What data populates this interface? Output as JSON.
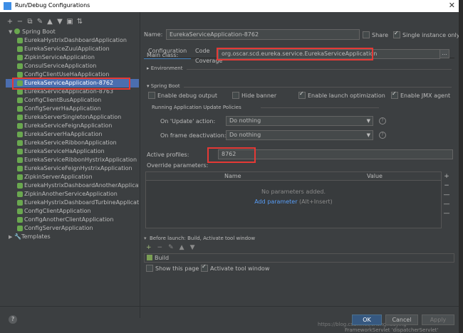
{
  "window": {
    "title": "Run/Debug Configurations"
  },
  "toolbar": {
    "icons": [
      "add-icon",
      "remove-icon",
      "copy-icon",
      "settings-icon",
      "move-up-icon",
      "move-down-icon",
      "folder-icon",
      "sort-icon"
    ]
  },
  "tree": {
    "root_label": "Spring Boot",
    "items": [
      "EurekaHystrixDashboardApplication",
      "EurekaServiceZuulApplication",
      "ZipkinServiceApplication",
      "ConsulServiceApplication",
      "ConfigClientUseHaApplication",
      "EurekaServiceApplication-8762",
      "EurekaServiceApplication-8763",
      "ConfigClientBusApplication",
      "ConfigServerHaApplication",
      "EurekaServerSingletonApplication",
      "EurekaServiceFeignApplication",
      "EurekaServerHaApplication",
      "EurekaServiceRibbonApplication",
      "EurekaServiceHaApplication",
      "EurekaServiceRibbonHystrixApplication",
      "EurekaServiceFeignHystrixApplication",
      "ZipkinServerApplication",
      "EurekaHystrixDashboardAnotherApplication",
      "ZipkinAnotherServiceApplication",
      "EurekaHystrixDashboardTurbineApplication",
      "ConfigClientApplication",
      "ConfigAnotherClientApplication",
      "ConfigServerApplication"
    ],
    "selected_index": 5,
    "templates_label": "Templates"
  },
  "config": {
    "name_label": "Name:",
    "name_value": "EurekaServiceApplication-8762",
    "share_label": "Share",
    "single_instance_label": "Single instance only",
    "tabs": [
      "Configuration",
      "Code Coverage",
      "Logs"
    ],
    "main_class_label": "Main class:",
    "main_class_value": "org.oscar.scd.eureka.service.EurekaServiceApplication",
    "browse_label": "...",
    "environment_label": "Environment",
    "spring_boot_label": "Spring Boot",
    "enable_debug_label": "Enable debug output",
    "hide_banner_label": "Hide banner",
    "enable_launch_opt_label": "Enable launch optimization",
    "enable_jmx_label": "Enable JMX agent",
    "policies_label": "Running Application Update Policies",
    "on_update_label": "On 'Update' action:",
    "on_update_value": "Do nothing",
    "on_frame_label": "On frame deactivation:",
    "on_frame_value": "Do nothing",
    "active_profiles_label": "Active profiles:",
    "active_profiles_value": "8762",
    "override_label": "Override parameters:",
    "col_name": "Name",
    "col_value": "Value",
    "no_params": "No parameters added.",
    "add_param_link": "Add parameter",
    "add_param_shortcut": "(Alt+Insert)"
  },
  "before_launch": {
    "label": "Before launch: Build, Activate tool window",
    "build_label": "Build",
    "show_page_label": "Show this page",
    "activate_label": "Activate tool window"
  },
  "buttons": {
    "ok": "OK",
    "cancel": "Cancel",
    "apply": "Apply",
    "help": "?"
  },
  "watermark": "https://blog.csdn.net/chonghuaying",
  "ide_background_text": "FrameworkServlet 'dispatcherServlet'",
  "colors": {
    "selection": "#4b6eaf",
    "highlight_box": "#e53935",
    "primary_button": "#365880"
  }
}
